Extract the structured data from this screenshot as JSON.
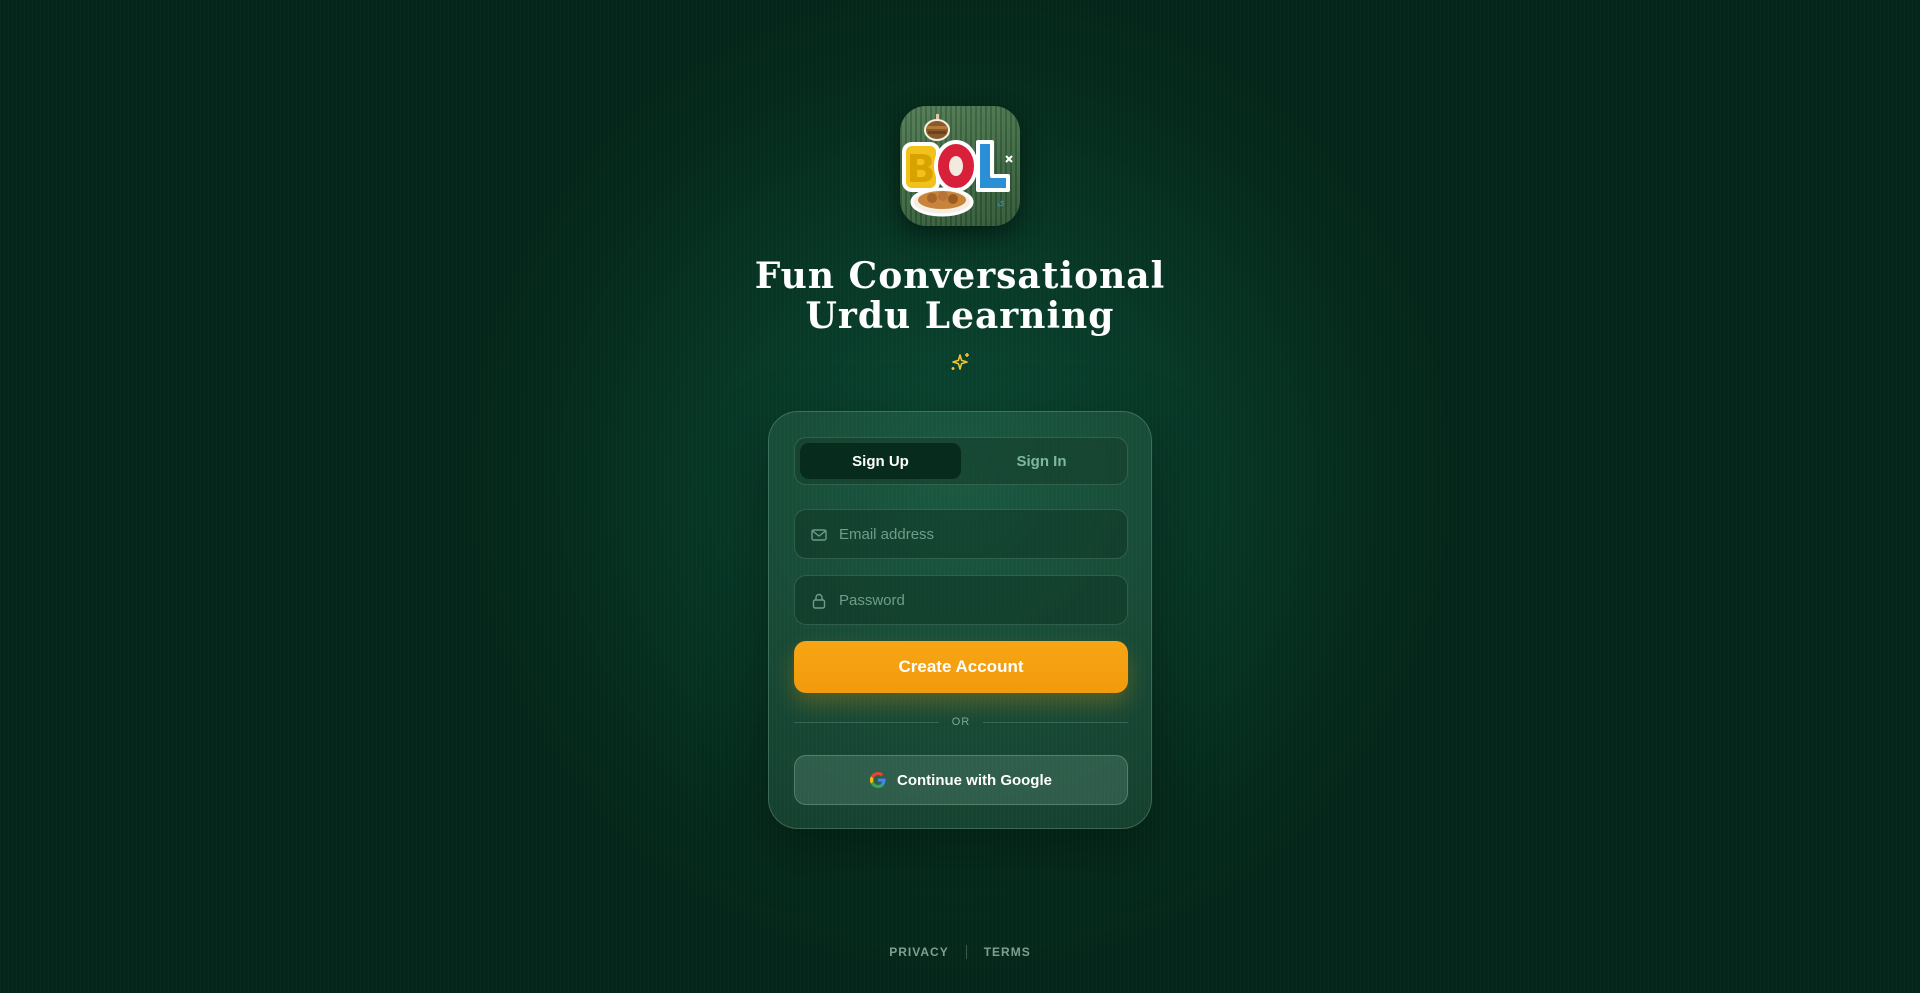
{
  "app": {
    "logo_icon": "bol-app-logo",
    "title_line1": "Fun Conversational",
    "title_line2": "Urdu Learning",
    "sparkle_icon": "sparkle-icon"
  },
  "auth": {
    "tabs": [
      {
        "label": "Sign Up",
        "active": true
      },
      {
        "label": "Sign In",
        "active": false
      }
    ],
    "email": {
      "placeholder": "Email address",
      "value": "",
      "icon": "mail-icon"
    },
    "password": {
      "placeholder": "Password",
      "value": "",
      "icon": "lock-icon"
    },
    "submit_label": "Create Account",
    "divider_label": "OR",
    "google_label": "Continue with Google",
    "google_icon": "google-icon"
  },
  "footer": {
    "privacy_label": "PRIVACY",
    "terms_label": "TERMS"
  },
  "colors": {
    "background": "#052c1d",
    "accent": "#f29b0c",
    "sparkle": "#f4c430",
    "inactive_tab_text": "#7fb8a0"
  }
}
